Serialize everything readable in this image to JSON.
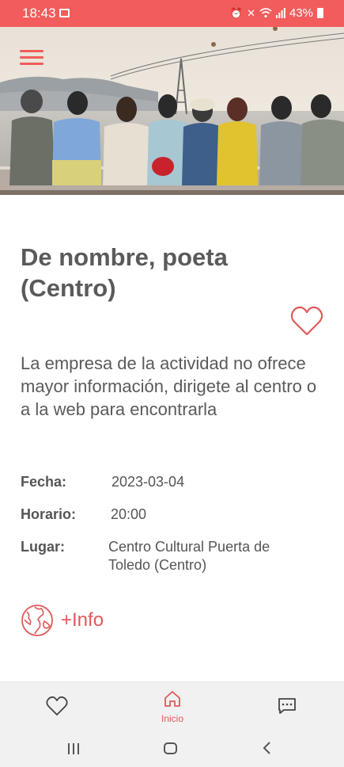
{
  "status_bar": {
    "time": "18:43",
    "battery": "43%",
    "icons": [
      "gallery-icon",
      "alarm-icon",
      "mute-icon",
      "wifi-icon",
      "signal-icon",
      "battery-icon"
    ]
  },
  "colors": {
    "accent": "#f25c5c",
    "link": "#e05a5a",
    "text": "#5a5a5a",
    "nav_bg": "#f1f1f1"
  },
  "header": {
    "menu_icon": "hamburger-menu-icon"
  },
  "event": {
    "title": "De nombre, poeta (Centro)",
    "favorite_icon": "heart-outline-icon",
    "description": "La empresa de la actividad no ofrece mayor información, dirigete al centro o a la web para encontrarla",
    "details": {
      "date_label": "Fecha:",
      "date_value": "2023-03-04",
      "time_label": "Horario:",
      "time_value": "20:00",
      "place_label": "Lugar:",
      "place_value": "Centro Cultural Puerta de Toledo (Centro)"
    },
    "info_link": {
      "icon": "globe-icon",
      "label": "+Info"
    }
  },
  "bottom_nav": {
    "items": [
      {
        "icon": "heart-icon",
        "label": ""
      },
      {
        "icon": "home-icon",
        "label": "Inicio",
        "active": true
      },
      {
        "icon": "chat-icon",
        "label": ""
      }
    ]
  },
  "system_nav": {
    "icons": [
      "recents-icon",
      "home-circle-icon",
      "back-icon"
    ]
  }
}
